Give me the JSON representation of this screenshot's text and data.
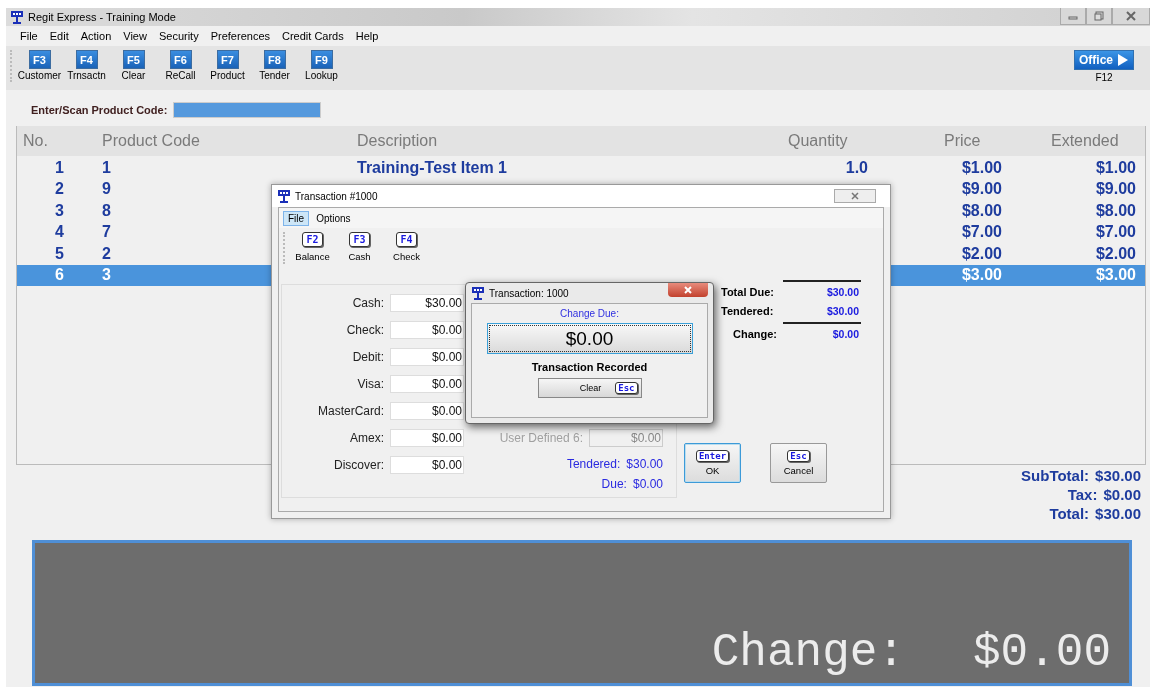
{
  "window": {
    "title": "Regit Express - Training Mode"
  },
  "menu": [
    {
      "label": "File"
    },
    {
      "label": "Edit"
    },
    {
      "label": "Action"
    },
    {
      "label": "View"
    },
    {
      "label": "Security"
    },
    {
      "label": "Preferences"
    },
    {
      "label": "Credit Cards"
    },
    {
      "label": "Help"
    }
  ],
  "toolbar": [
    {
      "key": "F3",
      "label": "Customer"
    },
    {
      "key": "F4",
      "label": "Trnsactn"
    },
    {
      "key": "F5",
      "label": "Clear"
    },
    {
      "key": "F6",
      "label": "ReCall"
    },
    {
      "key": "F7",
      "label": "Product"
    },
    {
      "key": "F8",
      "label": "Tender"
    },
    {
      "key": "F9",
      "label": "Lookup"
    }
  ],
  "office_button": {
    "label": "Office",
    "key": "F12"
  },
  "scan": {
    "label": "Enter/Scan Product Code:",
    "focused": true
  },
  "table": {
    "columns": [
      "No.",
      "Product Code",
      "Description",
      "Quantity",
      "Price",
      "Extended"
    ],
    "rows": [
      {
        "cells": [
          "1",
          "1",
          "Training-Test Item 1",
          "1.0",
          "$1.00",
          "$1.00"
        ],
        "selected": false
      },
      {
        "cells": [
          "2",
          "9",
          "",
          "",
          "$9.00",
          "$9.00"
        ],
        "selected": false
      },
      {
        "cells": [
          "3",
          "8",
          "",
          "",
          "$8.00",
          "$8.00"
        ],
        "selected": false
      },
      {
        "cells": [
          "4",
          "7",
          "",
          "",
          "$7.00",
          "$7.00"
        ],
        "selected": false
      },
      {
        "cells": [
          "5",
          "2",
          "",
          "",
          "$2.00",
          "$2.00"
        ],
        "selected": false
      },
      {
        "cells": [
          "6",
          "3",
          "",
          "",
          "$3.00",
          "$3.00"
        ],
        "selected": true
      }
    ]
  },
  "totals": [
    {
      "label": "SubTotal:",
      "value": "$30.00"
    },
    {
      "label": "Tax:",
      "value": "$0.00"
    },
    {
      "label": "Total:",
      "value": "$30.00"
    }
  ],
  "display": {
    "label": "Change:",
    "value": "$0.00"
  },
  "tender_dialog": {
    "title": "Transaction #1000",
    "menu": [
      {
        "label": "File",
        "selected": true
      },
      {
        "label": "Options",
        "selected": false
      }
    ],
    "toolbar": [
      {
        "key": "F2",
        "label": "Balance"
      },
      {
        "key": "F3",
        "label": "Cash"
      },
      {
        "key": "F4",
        "label": "Check"
      }
    ],
    "fields": [
      {
        "label": "Cash:",
        "value": "$30.00"
      },
      {
        "label": "Check:",
        "value": "$0.00"
      },
      {
        "label": "Debit:",
        "value": "$0.00"
      },
      {
        "label": "Visa:",
        "value": "$0.00"
      },
      {
        "label": "MasterCard:",
        "value": "$0.00"
      },
      {
        "label": "Amex:",
        "value": "$0.00"
      },
      {
        "label": "Discover:",
        "value": "$0.00"
      }
    ],
    "user_defined": {
      "label": "User Defined 6:",
      "value": "$0.00",
      "disabled": true
    },
    "tendered": {
      "label": "Tendered:",
      "value": "$30.00"
    },
    "due": {
      "label": "Due:",
      "value": "$0.00"
    },
    "summary": [
      {
        "label": "Total Due:",
        "value": "$30.00",
        "rule_above": true
      },
      {
        "label": "Tendered:",
        "value": "$30.00",
        "rule_above": false
      },
      {
        "label": "Change:",
        "value": "$0.00",
        "rule_above": true
      }
    ],
    "buttons": [
      {
        "key": "Enter",
        "label": "OK",
        "focused": true
      },
      {
        "key": "Esc",
        "label": "Cancel",
        "focused": false
      }
    ]
  },
  "change_dialog": {
    "title": "Transaction: 1000",
    "caption": "Change Due:",
    "amount": "$0.00",
    "status": "Transaction Recorded",
    "button": {
      "label": "Clear",
      "key": "Esc"
    }
  }
}
